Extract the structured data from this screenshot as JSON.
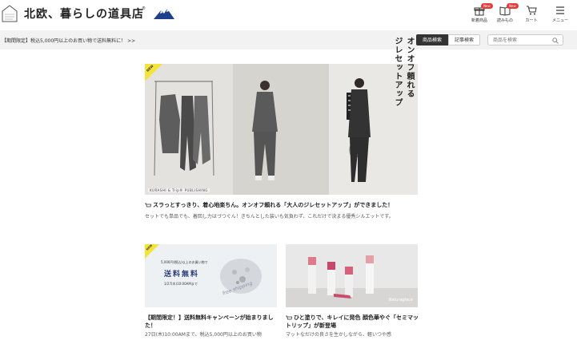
{
  "header": {
    "site_name": "北欧、暮らしの道具店",
    "registered_mark": "®",
    "nav": [
      {
        "label": "新着商品",
        "badge": "New",
        "icon": "gift-icon"
      },
      {
        "label": "読みもの",
        "badge": "New",
        "icon": "book-icon"
      },
      {
        "label": "カート",
        "icon": "cart-icon"
      },
      {
        "label": "メニュー",
        "icon": "menu-icon"
      }
    ]
  },
  "subbar": {
    "notice": "【期間限定】税込5,000円以上のお買い物で送料無料に！ >>",
    "tab_product": "商品検索",
    "tab_article": "記事検索",
    "search_placeholder": "商品を検索"
  },
  "hero": {
    "badge": "NEW",
    "caption": "KURASHI & Trip® PUBLISHING",
    "vertical_line1": "オンオフ頼れる",
    "vertical_line2": "ジレセットアップ",
    "title": "スラっとすっきり、着心地楽ちん。オンオフ頼れる「大人のジレセットアップ」ができました！",
    "desc": "セットでも単品でも、着回し力はづつぐん！きちんとした装いも気負わず、これだけで決まる優秀シルエットです。"
  },
  "card1": {
    "badge": "NEW",
    "line1": "5,000円(税込)以上のお買い物で",
    "big": "送料無料",
    "line2": "1/27(木)10:00AMまで",
    "script": "free shipping",
    "title": "【期間限定！】送料無料キャンペーンが始まりました！",
    "desc": "27日(木)10:00AMまで、税込5,000円以上のお買い物"
  },
  "card2": {
    "brand": "Naturaglacé",
    "title": "ひと塗りで、キレイに発色 顔色華やぐ「セミマットリップ」が新登場",
    "desc": "マットなだけの良さを生かしながら、軽いつや感"
  },
  "colors": {
    "accent": "#e03c3c",
    "new_yellow": "#f3e33b",
    "subbar_bg": "#f2f2f2"
  }
}
